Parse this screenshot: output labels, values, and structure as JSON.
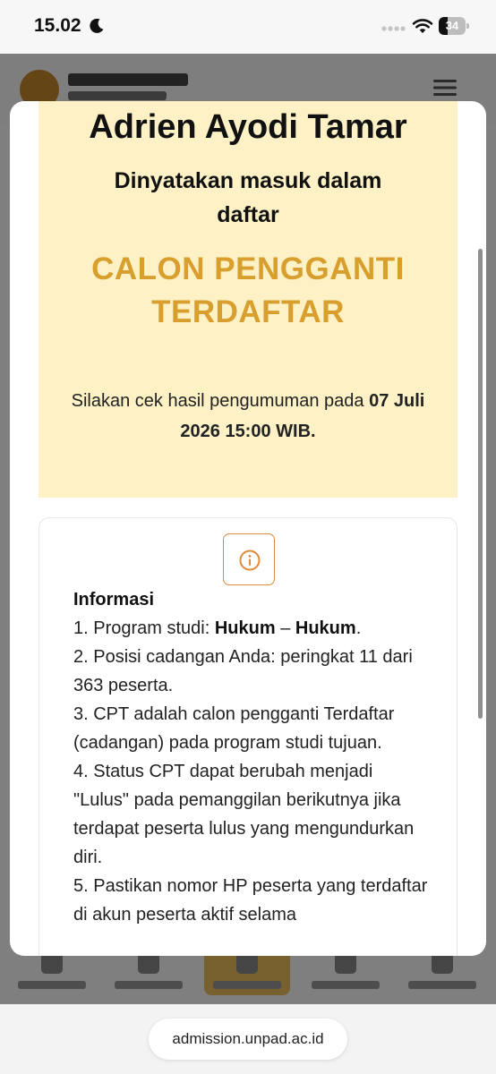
{
  "status_bar": {
    "time": "15.02",
    "battery_level": "34",
    "battery_fraction": 0.34
  },
  "icons": {
    "moon": "moon-icon",
    "wifi": "wifi-icon",
    "info": "info-circle-icon",
    "menu": "hamburger-menu-icon"
  },
  "colors": {
    "status_title": "#d89f2e",
    "result_card_bg": "#fdf1c5",
    "info_badge_border": "#e08a3c"
  },
  "result": {
    "name": "Adrien Ayodi Tamar",
    "admit_text": "Dinyatakan masuk dalam daftar",
    "status": "CALON PENGGANTI TERDAFTAR",
    "announce_prefix": "Silakan cek hasil pengumuman pada ",
    "announce_date": "07 Juli 2026 15:00 WIB."
  },
  "info": {
    "title": "Informasi",
    "item1_prefix": "1. Program studi: ",
    "item1_program": "Hukum",
    "item1_sep": " – ",
    "item1_faculty": "Hukum",
    "item1_suffix": ".",
    "item2": "2. Posisi cadangan Anda: peringkat 11 dari 363 peserta.",
    "item3": "3. CPT adalah calon pengganti Terdaftar (cadangan) pada program studi tujuan.",
    "item4": "4. Status CPT dapat berubah menjadi \"Lulus\" pada pemanggilan berikutnya jika terdapat peserta lulus yang mengundurkan diri.",
    "item5": "5. Pastikan nomor HP peserta yang terdaftar di akun peserta aktif selama"
  },
  "browser": {
    "url": "admission.unpad.ac.id"
  }
}
